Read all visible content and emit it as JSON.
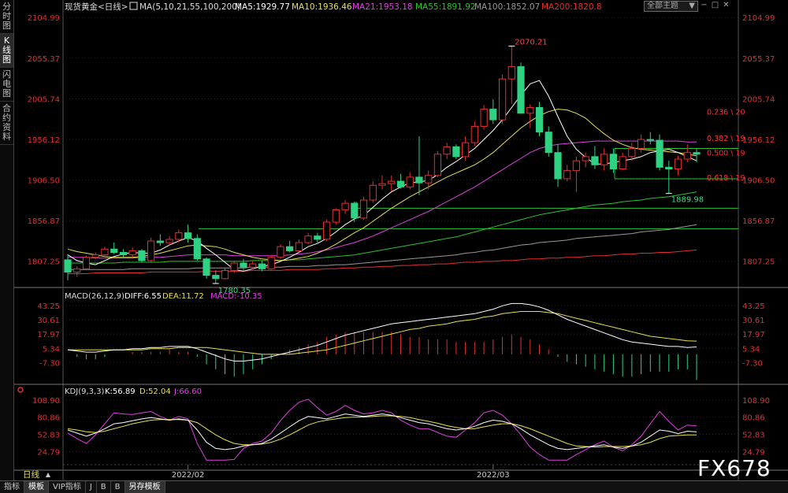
{
  "left_tabs": [
    "分时图",
    "K线图",
    "闪电图",
    "合约资料"
  ],
  "header": {
    "instrument": "现货黄金<日线>",
    "ma_label": "MA(5,10,21,55,100,200)",
    "ma5": "MA5:1929.77",
    "ma10": "MA10:1936.46",
    "ma21": "MA21:1953.18",
    "ma55": "MA55:1891.92",
    "ma100": "MA100:1852.07",
    "ma200": "MA200:1820.8"
  },
  "theme_select": "全部主题",
  "macd_header": {
    "label": "MACD(26,12,9)",
    "diff": "DIFF:6.55",
    "dea": "DEA:11.72",
    "macd": "MACD:-10.35"
  },
  "kdj_header": {
    "label": "KDJ(9,3,3)",
    "k": "K:56.89",
    "d": "D:52.04",
    "j": "J:66.60"
  },
  "period_label": "日线",
  "bottom_tabs": [
    "指标",
    "模板",
    "VIP指标",
    "J",
    "B",
    "B",
    "另存模板"
  ],
  "watermark": "FX678",
  "colors": {
    "up": "#e03030",
    "down": "#2fd183",
    "ma5": "#ffffff",
    "ma10": "#e8e050",
    "ma21": "#e040e0",
    "ma55": "#30c030",
    "ma100": "#999999",
    "ma200": "#e03030",
    "fib": "#ff3030",
    "support": "#30c030"
  },
  "chart_data": [
    {
      "type": "candlestick",
      "title": "现货黄金<日线>",
      "ylim": [
        1780,
        2110
      ],
      "y_ticks": [
        "2104.99",
        "2055.37",
        "2005.74",
        "1956.12",
        "1906.50",
        "1856.87",
        "1807.25"
      ],
      "x_tick_labels": [
        "2022/02",
        "2022/03"
      ],
      "annotations": {
        "high": "2070.21",
        "low1": "1780.35",
        "low2": "1889.98"
      },
      "fib_levels": [
        "0.236 \\ 20",
        "0.382 \\ 19",
        "0.500 \\ 19",
        "0.618 \\ 19"
      ],
      "ohlc": [
        [
          1809,
          1816,
          1784,
          1794
        ],
        [
          1794,
          1801,
          1788,
          1798
        ],
        [
          1798,
          1814,
          1796,
          1812
        ],
        [
          1812,
          1818,
          1810,
          1815
        ],
        [
          1815,
          1825,
          1813,
          1822
        ],
        [
          1822,
          1830,
          1816,
          1818
        ],
        [
          1818,
          1822,
          1812,
          1815
        ],
        [
          1815,
          1824,
          1812,
          1820
        ],
        [
          1820,
          1822,
          1806,
          1808
        ],
        [
          1808,
          1836,
          1806,
          1832
        ],
        [
          1832,
          1840,
          1826,
          1830
        ],
        [
          1830,
          1838,
          1826,
          1834
        ],
        [
          1834,
          1846,
          1830,
          1842
        ],
        [
          1842,
          1852,
          1830,
          1835
        ],
        [
          1835,
          1840,
          1808,
          1810
        ],
        [
          1810,
          1812,
          1786,
          1790
        ],
        [
          1790,
          1796,
          1780,
          1786
        ],
        [
          1786,
          1800,
          1785,
          1796
        ],
        [
          1796,
          1808,
          1793,
          1805
        ],
        [
          1805,
          1810,
          1796,
          1800
        ],
        [
          1800,
          1808,
          1797,
          1804
        ],
        [
          1804,
          1808,
          1795,
          1798
        ],
        [
          1798,
          1815,
          1797,
          1812
        ],
        [
          1812,
          1828,
          1810,
          1825
        ],
        [
          1825,
          1832,
          1818,
          1820
        ],
        [
          1820,
          1834,
          1818,
          1830
        ],
        [
          1830,
          1842,
          1828,
          1838
        ],
        [
          1838,
          1842,
          1830,
          1834
        ],
        [
          1834,
          1858,
          1832,
          1855
        ],
        [
          1855,
          1872,
          1852,
          1870
        ],
        [
          1870,
          1882,
          1865,
          1878
        ],
        [
          1878,
          1880,
          1855,
          1860
        ],
        [
          1860,
          1886,
          1858,
          1882
        ],
        [
          1882,
          1905,
          1879,
          1900
        ],
        [
          1900,
          1912,
          1895,
          1902
        ],
        [
          1902,
          1912,
          1893,
          1905
        ],
        [
          1905,
          1914,
          1896,
          1898
        ],
        [
          1898,
          1916,
          1895,
          1910
        ],
        [
          1910,
          1960,
          1888,
          1903
        ],
        [
          1903,
          1918,
          1895,
          1912
        ],
        [
          1912,
          1942,
          1910,
          1938
        ],
        [
          1938,
          1952,
          1932,
          1947
        ],
        [
          1947,
          1950,
          1932,
          1935
        ],
        [
          1935,
          1960,
          1930,
          1952
        ],
        [
          1952,
          1978,
          1948,
          1972
        ],
        [
          1972,
          1998,
          1968,
          1993
        ],
        [
          1993,
          2005,
          1975,
          1980
        ],
        [
          1980,
          2035,
          1975,
          2030
        ],
        [
          2030,
          2070,
          2000,
          2045
        ],
        [
          2045,
          2050,
          1995,
          1988
        ],
        [
          1988,
          1999,
          1970,
          1995
        ],
        [
          1995,
          2002,
          1960,
          1965
        ],
        [
          1965,
          1972,
          1935,
          1940
        ],
        [
          1940,
          1950,
          1898,
          1908
        ],
        [
          1908,
          1925,
          1905,
          1918
        ],
        [
          1918,
          1935,
          1892,
          1930
        ],
        [
          1930,
          1940,
          1922,
          1935
        ],
        [
          1935,
          1948,
          1920,
          1925
        ],
        [
          1925,
          1945,
          1918,
          1938
        ],
        [
          1938,
          1945,
          1915,
          1920
        ],
        [
          1920,
          1940,
          1918,
          1935
        ],
        [
          1935,
          1952,
          1930,
          1945
        ],
        [
          1945,
          1962,
          1940,
          1956
        ],
        [
          1956,
          1965,
          1950,
          1955
        ],
        [
          1955,
          1962,
          1918,
          1922
        ],
        [
          1922,
          1930,
          1890,
          1920
        ],
        [
          1920,
          1936,
          1912,
          1932
        ],
        [
          1932,
          1950,
          1928,
          1940
        ],
        [
          1940,
          1945,
          1928,
          1938
        ]
      ],
      "ma5": [
        1815,
        1808,
        1805,
        1803,
        1808,
        1813,
        1816,
        1818,
        1817,
        1817,
        1821,
        1827,
        1832,
        1836,
        1832,
        1823,
        1815,
        1806,
        1797,
        1795,
        1798,
        1801,
        1803,
        1807,
        1812,
        1818,
        1825,
        1829,
        1835,
        1843,
        1852,
        1859,
        1863,
        1873,
        1883,
        1892,
        1898,
        1903,
        1904,
        1906,
        1913,
        1922,
        1929,
        1937,
        1945,
        1956,
        1967,
        1980,
        1995,
        2010,
        2024,
        2028,
        2009,
        1984,
        1960,
        1944,
        1934,
        1926,
        1926,
        1928,
        1930,
        1932,
        1935,
        1940,
        1942,
        1944,
        1940,
        1935,
        1930
      ],
      "ma10": [
        1822,
        1819,
        1817,
        1815,
        1813,
        1812,
        1812,
        1812,
        1813,
        1815,
        1817,
        1820,
        1823,
        1826,
        1827,
        1826,
        1825,
        1822,
        1818,
        1815,
        1812,
        1810,
        1809,
        1808,
        1809,
        1811,
        1813,
        1817,
        1822,
        1828,
        1835,
        1842,
        1848,
        1856,
        1864,
        1872,
        1879,
        1886,
        1892,
        1898,
        1904,
        1910,
        1915,
        1920,
        1925,
        1932,
        1940,
        1950,
        1960,
        1970,
        1978,
        1985,
        1990,
        1993,
        1992,
        1988,
        1982,
        1972,
        1963,
        1955,
        1950,
        1946,
        1944,
        1943,
        1942,
        1941,
        1940,
        1938,
        1936
      ],
      "ma21": [
        1812,
        1812,
        1812,
        1811,
        1811,
        1811,
        1811,
        1811,
        1812,
        1812,
        1812,
        1813,
        1814,
        1815,
        1815,
        1815,
        1815,
        1815,
        1814,
        1814,
        1814,
        1814,
        1814,
        1814,
        1815,
        1816,
        1817,
        1819,
        1821,
        1824,
        1827,
        1830,
        1834,
        1838,
        1843,
        1848,
        1853,
        1858,
        1863,
        1868,
        1874,
        1880,
        1886,
        1892,
        1898,
        1905,
        1912,
        1919,
        1926,
        1933,
        1940,
        1945,
        1948,
        1950,
        1951,
        1952,
        1953,
        1954,
        1954,
        1954,
        1954,
        1954,
        1954,
        1954,
        1954,
        1954,
        1954,
        1953,
        1953
      ],
      "ma55": [
        1805,
        1805,
        1805,
        1805,
        1805,
        1805,
        1806,
        1806,
        1806,
        1806,
        1806,
        1807,
        1807,
        1807,
        1807,
        1807,
        1807,
        1807,
        1807,
        1807,
        1808,
        1808,
        1808,
        1808,
        1809,
        1809,
        1810,
        1811,
        1812,
        1813,
        1814,
        1815,
        1817,
        1819,
        1821,
        1823,
        1825,
        1827,
        1829,
        1831,
        1833,
        1835,
        1837,
        1840,
        1843,
        1846,
        1849,
        1852,
        1855,
        1858,
        1861,
        1864,
        1866,
        1868,
        1870,
        1872,
        1874,
        1876,
        1877,
        1878,
        1880,
        1881,
        1882,
        1884,
        1885,
        1886,
        1888,
        1890,
        1892
      ],
      "ma100": [
        1797,
        1797,
        1797,
        1797,
        1797,
        1797,
        1797,
        1798,
        1798,
        1798,
        1798,
        1798,
        1798,
        1798,
        1799,
        1799,
        1799,
        1799,
        1799,
        1799,
        1800,
        1800,
        1800,
        1800,
        1801,
        1801,
        1801,
        1802,
        1802,
        1803,
        1803,
        1804,
        1805,
        1806,
        1807,
        1808,
        1809,
        1810,
        1811,
        1812,
        1813,
        1814,
        1815,
        1817,
        1818,
        1820,
        1821,
        1823,
        1825,
        1827,
        1828,
        1830,
        1831,
        1832,
        1833,
        1835,
        1836,
        1837,
        1838,
        1839,
        1840,
        1841,
        1843,
        1844,
        1845,
        1846,
        1848,
        1850,
        1852
      ],
      "ma200": [
        1792,
        1792,
        1792,
        1793,
        1793,
        1793,
        1793,
        1793,
        1793,
        1794,
        1794,
        1794,
        1794,
        1794,
        1794,
        1795,
        1795,
        1795,
        1795,
        1795,
        1796,
        1796,
        1796,
        1796,
        1797,
        1797,
        1797,
        1797,
        1798,
        1798,
        1799,
        1799,
        1800,
        1800,
        1801,
        1801,
        1802,
        1802,
        1803,
        1803,
        1804,
        1804,
        1805,
        1806,
        1806,
        1807,
        1807,
        1808,
        1808,
        1809,
        1810,
        1810,
        1811,
        1811,
        1812,
        1812,
        1813,
        1814,
        1814,
        1815,
        1816,
        1816,
        1817,
        1817,
        1818,
        1818,
        1819,
        1820,
        1821
      ]
    },
    {
      "type": "bar",
      "title": "MACD(26,12,9)",
      "ylim": [
        -14,
        46
      ],
      "y_ticks": [
        "43.25",
        "30.61",
        "17.97",
        "5.34",
        "-7.30"
      ],
      "diff": [
        4,
        3,
        2,
        2,
        3,
        4,
        4,
        5,
        5,
        6,
        6,
        7,
        7,
        7,
        5,
        2,
        -1,
        -4,
        -6,
        -6,
        -5,
        -4,
        -2,
        0,
        2,
        4,
        6,
        8,
        11,
        14,
        17,
        19,
        21,
        23,
        25,
        27,
        28,
        29,
        30,
        31,
        32,
        33,
        34,
        35,
        36,
        38,
        40,
        43,
        45,
        45,
        44,
        42,
        39,
        35,
        31,
        28,
        25,
        22,
        19,
        16,
        13,
        11,
        10,
        9,
        8,
        7,
        7,
        6,
        6.55
      ],
      "dea": [
        4,
        4,
        4,
        4,
        4,
        4,
        4,
        4,
        4,
        5,
        5,
        5,
        6,
        6,
        6,
        6,
        5,
        4,
        3,
        2,
        1,
        0,
        0,
        0,
        0,
        1,
        2,
        3,
        4,
        6,
        8,
        10,
        12,
        14,
        16,
        18,
        20,
        22,
        23,
        25,
        26,
        27,
        29,
        30,
        31,
        33,
        34,
        36,
        37,
        38,
        38,
        38,
        37,
        36,
        34,
        32,
        30,
        28,
        26,
        24,
        22,
        20,
        18,
        16,
        15,
        14,
        13,
        12,
        11.72
      ],
      "macd": [
        0,
        -1,
        -2,
        -2,
        -1,
        0,
        0,
        1,
        1,
        1,
        1,
        2,
        1,
        1,
        -1,
        -4,
        -6,
        -8,
        -9,
        -8,
        -6,
        -4,
        -2,
        0,
        2,
        3,
        4,
        5,
        7,
        8,
        9,
        9,
        9,
        9,
        9,
        9,
        8,
        7,
        7,
        6,
        6,
        6,
        5,
        5,
        5,
        5,
        6,
        7,
        8,
        7,
        6,
        4,
        2,
        -1,
        -3,
        -4,
        -5,
        -6,
        -7,
        -8,
        -9,
        -9,
        -8,
        -7,
        -7,
        -7,
        -6,
        -6,
        -10.35
      ]
    },
    {
      "type": "line",
      "title": "KDJ(9,3,3)",
      "ylim": [
        10,
        115
      ],
      "y_ticks": [
        "108.90",
        "80.86",
        "52.83",
        "24.79"
      ],
      "k": [
        60,
        55,
        50,
        55,
        62,
        70,
        72,
        75,
        78,
        80,
        78,
        76,
        78,
        76,
        60,
        40,
        30,
        28,
        30,
        34,
        36,
        38,
        45,
        55,
        65,
        75,
        82,
        80,
        78,
        82,
        86,
        84,
        82,
        84,
        86,
        84,
        80,
        76,
        72,
        70,
        66,
        62,
        60,
        62,
        66,
        72,
        76,
        74,
        70,
        62,
        52,
        44,
        36,
        30,
        28,
        30,
        32,
        34,
        36,
        32,
        30,
        34,
        40,
        50,
        60,
        58,
        54,
        58,
        56.89
      ],
      "d": [
        62,
        60,
        57,
        56,
        58,
        62,
        66,
        70,
        73,
        76,
        77,
        77,
        77,
        76,
        72,
        62,
        52,
        44,
        38,
        36,
        36,
        37,
        40,
        45,
        52,
        60,
        68,
        73,
        76,
        78,
        80,
        81,
        81,
        82,
        83,
        83,
        82,
        80,
        77,
        74,
        71,
        67,
        64,
        62,
        62,
        65,
        68,
        70,
        70,
        67,
        62,
        56,
        50,
        44,
        38,
        34,
        33,
        32,
        33,
        33,
        33,
        34,
        36,
        40,
        46,
        50,
        51,
        52,
        52.04
      ],
      "j": [
        55,
        46,
        38,
        52,
        70,
        88,
        86,
        85,
        88,
        90,
        82,
        76,
        82,
        78,
        38,
        0,
        0,
        0,
        12,
        30,
        38,
        42,
        55,
        75,
        92,
        105,
        110,
        96,
        84,
        90,
        100,
        92,
        86,
        88,
        92,
        88,
        76,
        68,
        62,
        62,
        56,
        50,
        48,
        60,
        72,
        88,
        92,
        84,
        70,
        52,
        32,
        20,
        10,
        2,
        6,
        20,
        28,
        36,
        42,
        32,
        26,
        36,
        50,
        70,
        90,
        74,
        60,
        68,
        66.6
      ]
    }
  ]
}
